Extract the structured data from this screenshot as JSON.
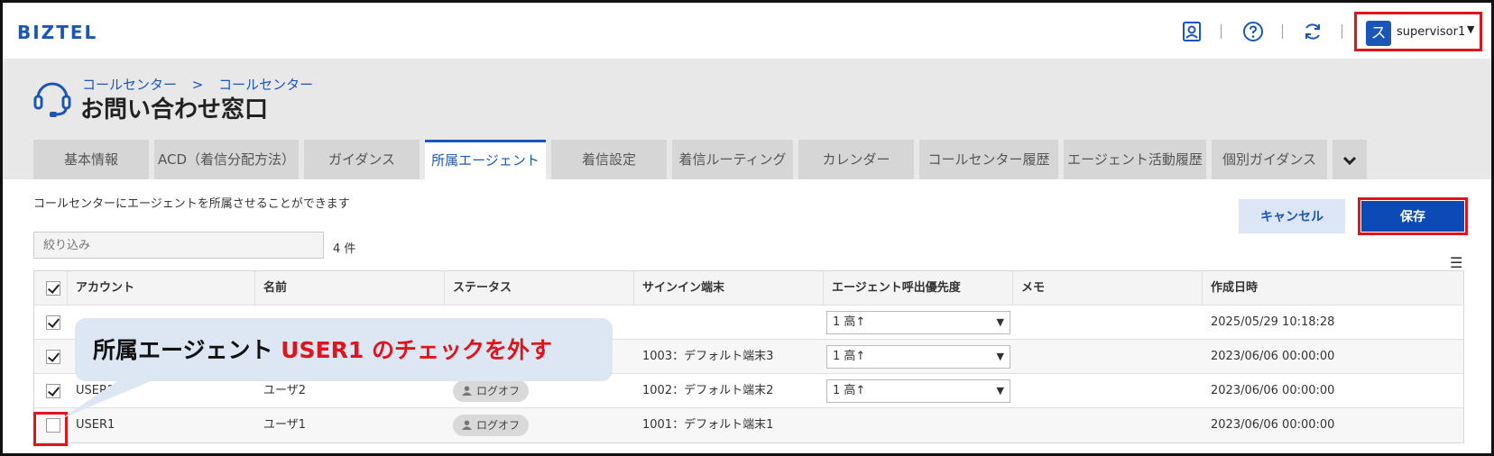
{
  "app": {
    "logo": "BIZTEL"
  },
  "topbar": {
    "avatar_initial": "ス",
    "user_name": "supervisor1",
    "icons": [
      "agent-profile-icon",
      "help-icon",
      "refresh-icon"
    ]
  },
  "breadcrumb": {
    "parent": "コールセンター",
    "separator": ">",
    "current": "コールセンター"
  },
  "page_title": "お問い合わせ窓口",
  "tabs": [
    {
      "label": "基本情報"
    },
    {
      "label": "ACD（着信分配方法）"
    },
    {
      "label": "ガイダンス"
    },
    {
      "label": "所属エージェント",
      "active": true
    },
    {
      "label": "着信設定"
    },
    {
      "label": "着信ルーティング"
    },
    {
      "label": "カレンダー"
    },
    {
      "label": "コールセンター履歴"
    },
    {
      "label": "エージェント活動履歴"
    },
    {
      "label": "個別ガイダンス"
    }
  ],
  "content": {
    "description": "コールセンターにエージェントを所属させることができます",
    "filter_placeholder": "絞り込み",
    "count": "4 件",
    "cancel_label": "キャンセル",
    "save_label": "保存"
  },
  "table": {
    "headers": [
      "アカウント",
      "名前",
      "ステータス",
      "サインイン端末",
      "エージェント呼出優先度",
      "メモ",
      "作成日時"
    ],
    "rows": [
      {
        "checked": true,
        "account": "",
        "name": "",
        "status": "",
        "terminal": "",
        "priority": "1 高↑",
        "memo": "",
        "created": "2025/05/29 10:18:28"
      },
      {
        "checked": true,
        "account": "",
        "name": "",
        "status": "",
        "terminal": "1003：デフォルト端末3",
        "priority": "1 高↑",
        "memo": "",
        "created": "2023/06/06 00:00:00"
      },
      {
        "checked": true,
        "account": "USER2",
        "name": "ユーザ2",
        "status": "ログオフ",
        "terminal": "1002：デフォルト端末2",
        "priority": "1 高↑",
        "memo": "",
        "created": "2023/06/06 00:00:00"
      },
      {
        "checked": false,
        "account": "USER1",
        "name": "ユーザ1",
        "status": "ログオフ",
        "terminal": "1001：デフォルト端末1",
        "priority": "",
        "memo": "",
        "created": "2023/06/06 00:00:00"
      }
    ]
  },
  "callout": {
    "prefix": "所属エージェント ",
    "highlight": "USER1 のチェックを外す"
  },
  "colors": {
    "accent": "#1a56b8",
    "highlight_red": "#e0141c",
    "callout_bg": "#dde7f3"
  }
}
